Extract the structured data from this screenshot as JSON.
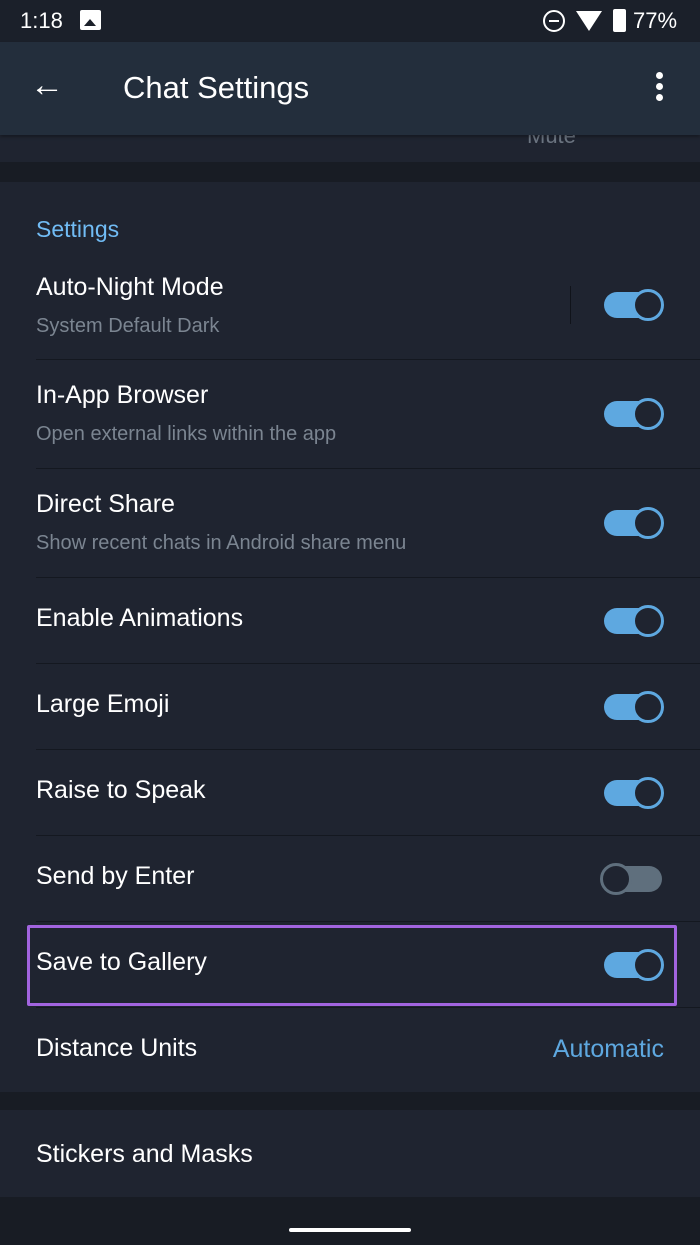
{
  "status_bar": {
    "time": "1:18",
    "battery": "77%",
    "icons": [
      "image-icon",
      "dnd-icon",
      "wifi-icon",
      "battery-icon"
    ]
  },
  "header": {
    "title": "Chat Settings",
    "back_icon": "arrow-left-icon",
    "menu_icon": "more-vertical-icon"
  },
  "partial_row": {
    "text": "Mute"
  },
  "section": {
    "title": "Settings",
    "items": [
      {
        "label": "Auto-Night Mode",
        "sub": "System Default Dark",
        "on": true
      },
      {
        "label": "In-App Browser",
        "sub": "Open external links within the app",
        "on": true
      },
      {
        "label": "Direct Share",
        "sub": "Show recent chats in Android share menu",
        "on": true
      },
      {
        "label": "Enable Animations",
        "on": true
      },
      {
        "label": "Large Emoji",
        "on": true
      },
      {
        "label": "Raise to Speak",
        "on": true
      },
      {
        "label": "Send by Enter",
        "on": false
      },
      {
        "label": "Save to Gallery",
        "on": true,
        "highlighted": true
      },
      {
        "label": "Distance Units",
        "value": "Automatic"
      }
    ]
  },
  "stickers": {
    "label": "Stickers and Masks"
  },
  "colors": {
    "accent": "#5ea8e0",
    "section_title": "#71bcf5",
    "highlight": "#a264df",
    "background": "#1f2430",
    "header": "#232e3c"
  }
}
